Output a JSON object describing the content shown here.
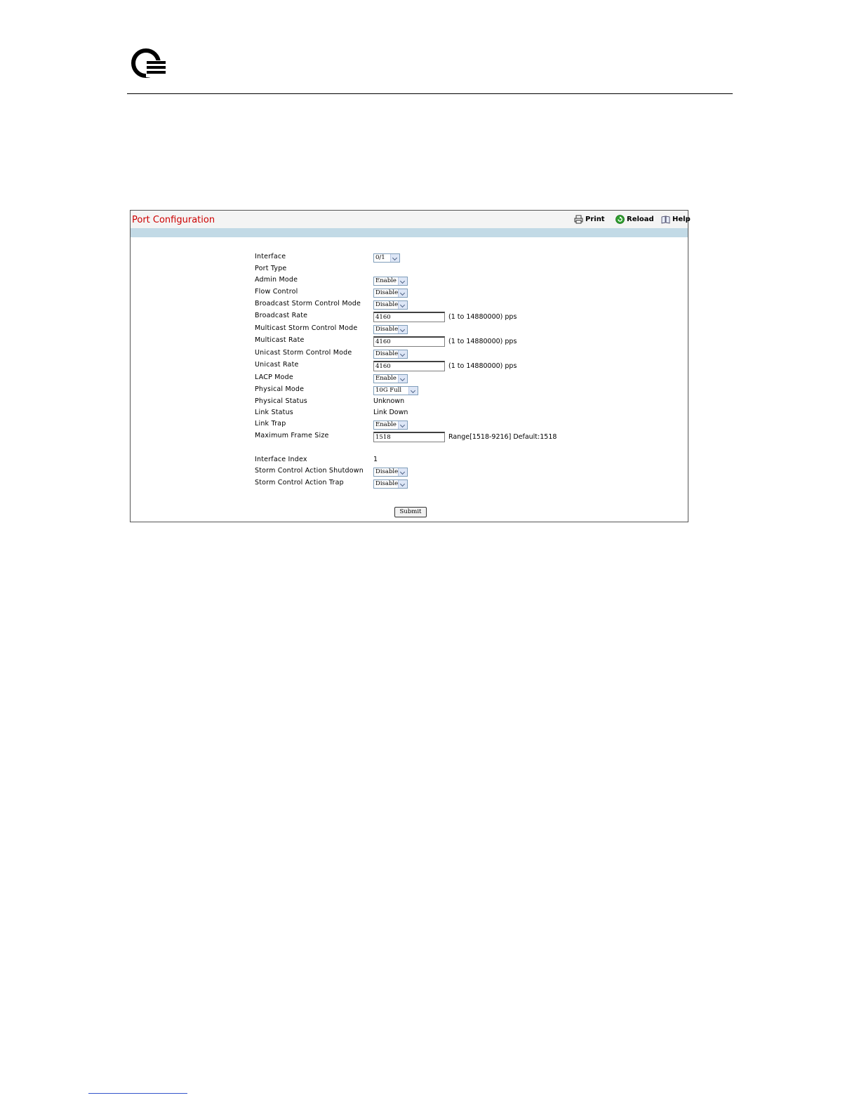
{
  "panel": {
    "title": "Port Configuration",
    "toolbar": {
      "print": "Print",
      "reload": "Reload",
      "help": "Help"
    }
  },
  "form": {
    "interface": {
      "label": "Interface",
      "value": "0/1"
    },
    "port_type": {
      "label": "Port Type",
      "value": ""
    },
    "admin_mode": {
      "label": "Admin Mode",
      "value": "Enable"
    },
    "flow_control": {
      "label": "Flow Control",
      "value": "Disable"
    },
    "broadcast_storm_mode": {
      "label": "Broadcast Storm Control Mode",
      "value": "Disable"
    },
    "broadcast_rate": {
      "label": "Broadcast Rate",
      "value": "4160",
      "hint": "(1 to 14880000) pps"
    },
    "multicast_storm_mode": {
      "label": "Multicast Storm Control Mode",
      "value": "Disable"
    },
    "multicast_rate": {
      "label": "Multicast Rate",
      "value": "4160",
      "hint": "(1 to 14880000) pps"
    },
    "unicast_storm_mode": {
      "label": "Unicast Storm Control Mode",
      "value": "Disable"
    },
    "unicast_rate": {
      "label": "Unicast Rate",
      "value": "4160",
      "hint": "(1 to 14880000) pps"
    },
    "lacp_mode": {
      "label": "LACP Mode",
      "value": "Enable"
    },
    "physical_mode": {
      "label": "Physical Mode",
      "value": "10G Full"
    },
    "physical_status": {
      "label": "Physical Status",
      "value": "Unknown"
    },
    "link_status": {
      "label": "Link Status",
      "value": "Link Down"
    },
    "link_trap": {
      "label": "Link Trap",
      "value": "Enable"
    },
    "max_frame_size": {
      "label": "Maximum Frame Size",
      "value": "1518",
      "hint": "Range[1518-9216] Default:1518"
    },
    "interface_index": {
      "label": "Interface Index",
      "value": "1"
    },
    "storm_action_shutdown": {
      "label": "Storm Control Action Shutdown",
      "value": "Disable"
    },
    "storm_action_trap": {
      "label": "Storm Control Action Trap",
      "value": "Disable"
    }
  },
  "submit_label": "Submit"
}
